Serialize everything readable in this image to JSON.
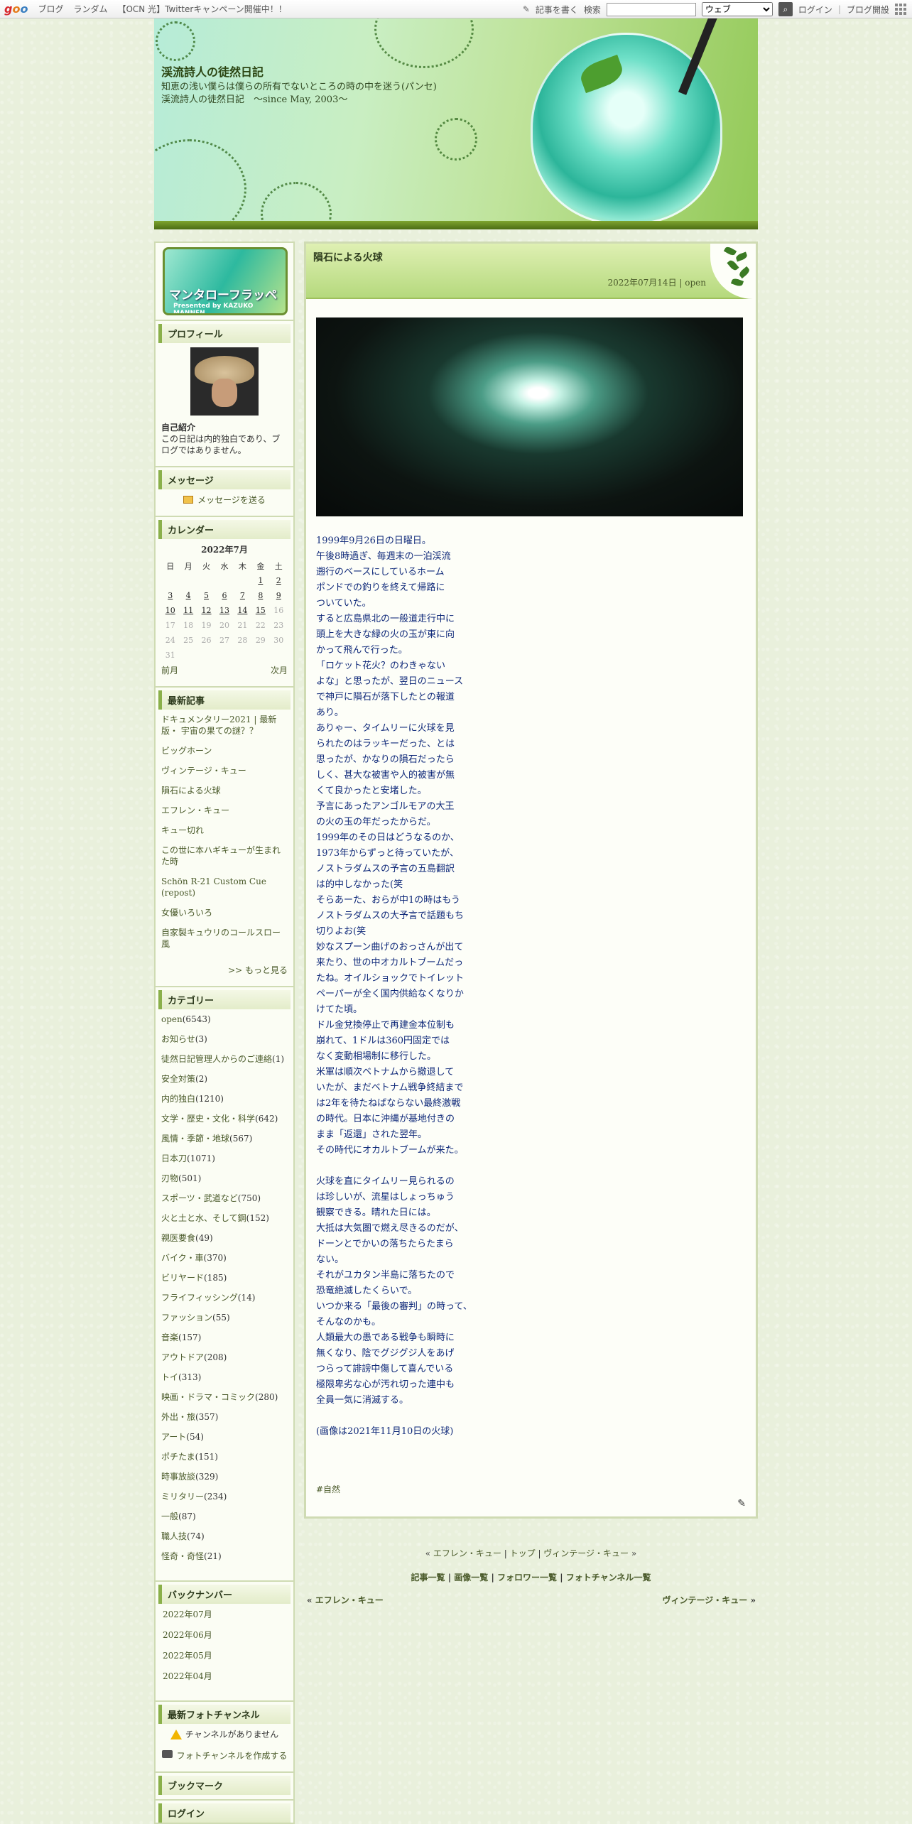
{
  "topbar": {
    "logo": [
      "g",
      "o",
      "o"
    ],
    "links": [
      "ブログ",
      "ランダム",
      "【OCN 光】Twitterキャンペーン開催中！！"
    ],
    "write": "記事を書く",
    "search_label": "検索",
    "search_value": "",
    "select_value": "ウェブ",
    "login": "ログイン",
    "open_blog": "ブログ開設"
  },
  "header": {
    "title": "渓流詩人の徒然日記",
    "description": "知恵の浅い僕らは僕らの所有でないところの時の中を迷う(パンセ)　渓流詩人の徒然日記　～since May, 2003～"
  },
  "sidebar": {
    "banner_title": "マンタローフラッペ",
    "banner_sub": "Presented by KAZUKO MANNEN",
    "profile": {
      "heading": "プロフィール",
      "intro_label": "自己紹介",
      "intro_text": "この日記は内的独白であり、ブログではありません。"
    },
    "message": {
      "heading": "メッセージ",
      "link": "メッセージを送る"
    },
    "calendar": {
      "heading": "カレンダー",
      "month": "2022年7月",
      "weekdays": [
        "日",
        "月",
        "火",
        "水",
        "木",
        "金",
        "土"
      ],
      "weeks": [
        [
          "",
          "",
          "",
          "",
          "",
          "1",
          "2"
        ],
        [
          "3",
          "4",
          "5",
          "6",
          "7",
          "8",
          "9"
        ],
        [
          "10",
          "11",
          "12",
          "13",
          "14",
          "15",
          "16"
        ],
        [
          "17",
          "18",
          "19",
          "20",
          "21",
          "22",
          "23"
        ],
        [
          "24",
          "25",
          "26",
          "27",
          "28",
          "29",
          "30"
        ],
        [
          "31",
          "",
          "",
          "",
          "",
          "",
          ""
        ]
      ],
      "linked_days": [
        "1",
        "2",
        "3",
        "4",
        "5",
        "6",
        "7",
        "8",
        "9",
        "10",
        "11",
        "12",
        "13",
        "14",
        "15"
      ],
      "prev": "前月",
      "next": "次月"
    },
    "recent": {
      "heading": "最新記事",
      "items": [
        "ドキュメンタリー2021 | 最新版・ 宇宙の果ての謎？？",
        "ビッグホーン",
        "ヴィンテージ・キュー",
        "隕石による火球",
        "エフレン・キュー",
        "キュー切れ",
        "この世に本ハギキューが生まれた時",
        "Schön R-21 Custom Cue　(repost)",
        "女優いろいろ",
        "自家製キュウリのコールスロー風"
      ],
      "more": ">> もっと見る"
    },
    "category": {
      "heading": "カテゴリー",
      "items": [
        {
          "name": "open",
          "count": "(6543)"
        },
        {
          "name": "お知らせ",
          "count": "(3)"
        },
        {
          "name": "徒然日記管理人からのご連絡",
          "count": "(1)"
        },
        {
          "name": "安全対策",
          "count": "(2)"
        },
        {
          "name": "内的独白",
          "count": "(1210)"
        },
        {
          "name": "文学・歴史・文化・科学",
          "count": "(642)"
        },
        {
          "name": "風情・季節・地球",
          "count": "(567)"
        },
        {
          "name": "日本刀",
          "count": "(1071)"
        },
        {
          "name": "刃物",
          "count": "(501)"
        },
        {
          "name": "スポーツ・武道など",
          "count": "(750)"
        },
        {
          "name": "火と土と水、そして鋼",
          "count": "(152)"
        },
        {
          "name": "親医要食",
          "count": "(49)"
        },
        {
          "name": "バイク・車",
          "count": "(370)"
        },
        {
          "name": "ビリヤード",
          "count": "(185)"
        },
        {
          "name": "フライフィッシング",
          "count": "(14)"
        },
        {
          "name": "ファッション",
          "count": "(55)"
        },
        {
          "name": "音楽",
          "count": "(157)"
        },
        {
          "name": "アウトドア",
          "count": "(208)"
        },
        {
          "name": "トイ",
          "count": "(313)"
        },
        {
          "name": "映画・ドラマ・コミック",
          "count": "(280)"
        },
        {
          "name": "外出・旅",
          "count": "(357)"
        },
        {
          "name": "アート",
          "count": "(54)"
        },
        {
          "name": "ポチたま",
          "count": "(151)"
        },
        {
          "name": "時事放談",
          "count": "(329)"
        },
        {
          "name": "ミリタリー",
          "count": "(234)"
        },
        {
          "name": "一般",
          "count": "(87)"
        },
        {
          "name": "職人技",
          "count": "(74)"
        },
        {
          "name": "怪奇・奇怪",
          "count": "(21)"
        }
      ]
    },
    "backnumber": {
      "heading": "バックナンバー",
      "items": [
        "2022年07月",
        "2022年06月",
        "2022年05月",
        "2022年04月"
      ]
    },
    "photo": {
      "heading": "最新フォトチャンネル",
      "none": "チャンネルがありません",
      "create": "フォトチャンネルを作成する"
    },
    "bookmark": {
      "heading": "ブックマーク"
    },
    "login": {
      "heading": "ログイン"
    }
  },
  "post": {
    "title": "隕石による火球",
    "date": "2022年07月14日",
    "sep": " | ",
    "category": "open",
    "body": "1999年9月26日の日曜日。\n午後8時過ぎ、毎週末の一泊渓流\n遡行のベースにしているホーム\nポンドでの釣りを終えて帰路に\nついていた。\nすると広島県北の一般道走行中に\n頭上を大きな緑の火の玉が東に向\nかって飛んで行った。\n「ロケット花火？のわきゃない\nよな」と思ったが、翌日のニュース\nで神戸に隕石が落下したとの報道\nあり。\nありゃー、タイムリーに火球を見\nられたのはラッキーだった、とは\n思ったが、かなりの隕石だったら\nしく、甚大な被害や人的被害が無\nくて良かったと安堵した。\n予言にあったアンゴルモアの大王\nの火の玉の年だったからだ。\n1999年のその日はどうなるのか、\n1973年からずっと待っていたが、\nノストラダムスの予言の五島翻訳\nは的中しなかった(笑\nそらあーた、おらが中1の時はもう\nノストラダムスの大予言で話題もち\n切りよお(笑\n妙なスプーン曲げのおっさんが出て\n来たり、世の中オカルトブームだっ\nたね。オイルショックでトイレット\nペーパーが全く国内供給なくなりか\nけてた頃。\nドル金兌換停止で再建金本位制も\n崩れて、1ドルは360円固定では\nなく変動相場制に移行した。\n米軍は順次ベトナムから撤退して\nいたが、まだベトナム戦争終結まで\nは2年を待たねばならない最終激戦\nの時代。日本に沖縄が基地付きの\nまま「返還」された翌年。\nその時代にオカルトブームが来た。\n\n火球を直にタイムリー見られるの\nは珍しいが、流星はしょっちゅう\n観察できる。晴れた日には。\n大抵は大気圏で燃え尽きるのだが、\nドーンとでかいの落ちたらたまら\nない。\nそれがユカタン半島に落ちたので\n恐竜絶滅したくらいで。\nいつか来る「最後の審判」の時って、\nそんなのかも。\n人類最大の愚である戦争も瞬時に\n無くなり、陰でグジグジ人をあげ\nつらって誹謗中傷して喜んでいる\n極限卑劣な心が汚れ切った連中も\n全員一気に消滅する。\n\n(画像は2021年11月10日の火球)",
    "tag": "#自然"
  },
  "footer": {
    "prev": "エフレン・キュー",
    "top": "トップ",
    "next": "ヴィンテージ・キュー",
    "list_links": [
      "記事一覧",
      "画像一覧",
      "フォロワー一覧",
      "フォトチャンネル一覧"
    ]
  }
}
